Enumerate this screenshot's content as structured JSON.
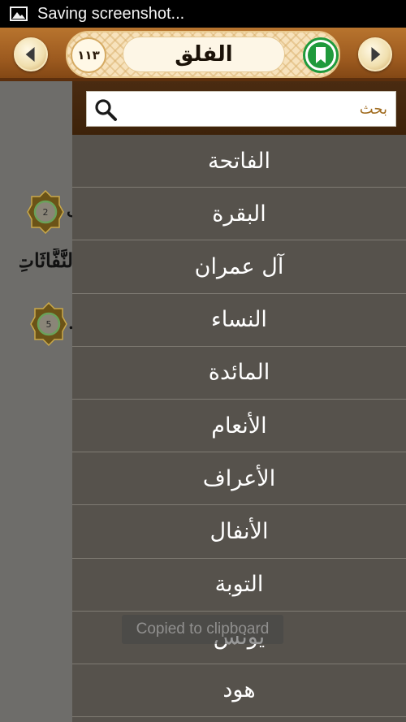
{
  "status_bar": {
    "notification_text": "Saving screenshot...",
    "icon": "image-icon"
  },
  "header": {
    "surah_title": "الفلق",
    "surah_number": "١١٣",
    "prev_icon": "chevron-left-icon",
    "next_icon": "chevron-right-icon",
    "bookmark_icon": "bookmark-icon",
    "accent_color": "#9c5a1f",
    "bookmark_color": "#1f9a3c"
  },
  "background_content": {
    "ayah_markers": [
      "2",
      "5"
    ],
    "partial_word": "لنَّفَّاثَاتِ"
  },
  "search": {
    "placeholder": "بحث",
    "value": ""
  },
  "surah_list": [
    "الفاتحة",
    "البقرة",
    "آل عمران",
    "النساء",
    "المائدة",
    "الأنعام",
    "الأعراف",
    "الأنفال",
    "التوبة",
    "يونس",
    "هود"
  ],
  "toast": {
    "message": "Copied to clipboard"
  }
}
